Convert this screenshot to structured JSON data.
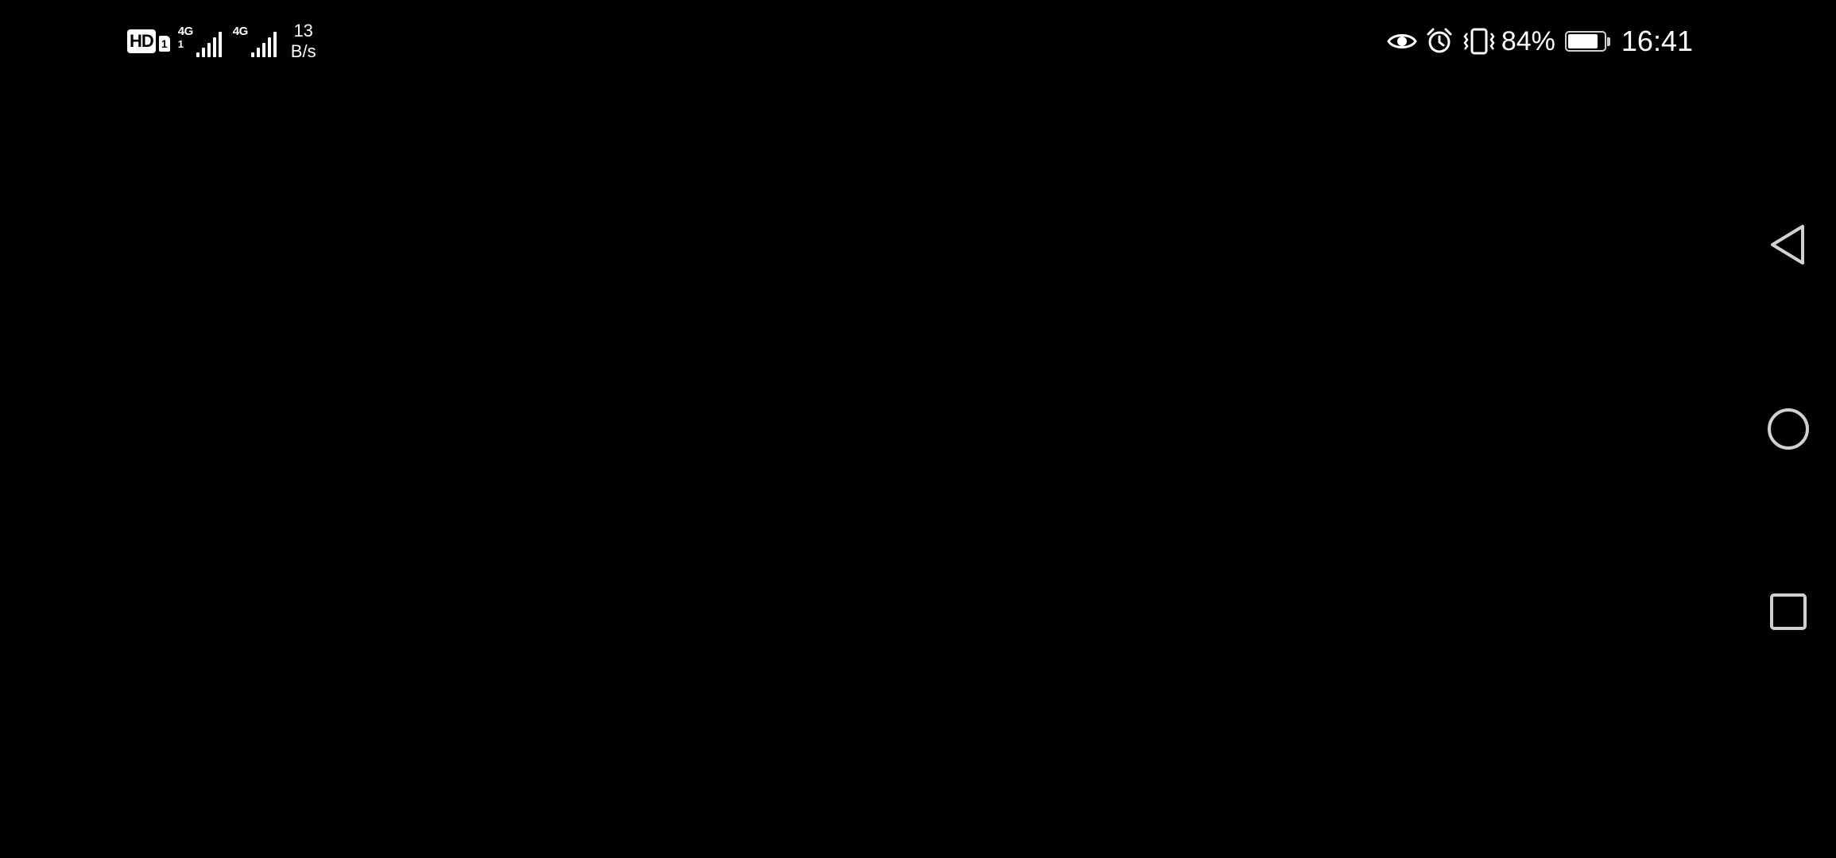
{
  "status_bar": {
    "hd_label": "HD",
    "sim_label": "1",
    "signals": [
      {
        "network": "4G",
        "sub": "1",
        "strength_bars": 5
      },
      {
        "network": "4G",
        "sub": "",
        "strength_bars": 5
      }
    ],
    "speed_value": "13",
    "speed_unit": "B/s",
    "battery_percent": "84%",
    "battery_level": 0.84,
    "time": "16:41",
    "icons": [
      "eye-comfort-icon",
      "alarm-icon",
      "vibrate-icon"
    ]
  },
  "navigation": {
    "buttons": [
      "back-icon",
      "home-icon",
      "recents-icon"
    ]
  },
  "colors": {
    "background": "#000000",
    "foreground": "#ffffff",
    "nav_icon": "#d0d0d0"
  }
}
